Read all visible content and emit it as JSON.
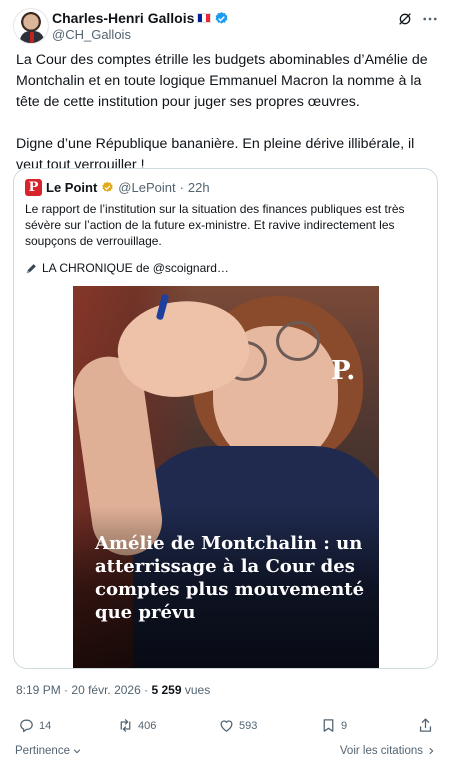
{
  "author": {
    "name": "Charles-Henri Gallois",
    "handle": "@CH_Gallois",
    "flag_colors": [
      "#002395",
      "#ffffff",
      "#ed2939"
    ],
    "verified_color": "#1d9bf0"
  },
  "tweet": {
    "paragraphs": [
      "La Cour des comptes étrille les budgets abominables d’Amélie de Montchalin et en toute logique Emmanuel Macron la nomme à la tête de cette institution pour juger ses propres œuvres.",
      "Digne d’une République bananière. En pleine dérive illibérale, il veut tout verrouiller !"
    ]
  },
  "quote": {
    "avatar_letter": "P",
    "name": "Le Point",
    "handle": "@LePoint",
    "separator": "·",
    "time": "22h",
    "text": "Le rapport de l’institution sur la situation des finances publiques est très sévère sur l’action de la future ex-ministre. Et ravive indirectement les soupçons de verrouillage.",
    "chronique": "LA CHRONIQUE de @scoignard…",
    "image": {
      "logo": "P.",
      "headline": "Amélie de Montchalin : un atterrissage à la Cour des comptes plus mouvementé que prévu"
    },
    "verified_color": "#e3a81b"
  },
  "meta": {
    "time": "8:19 PM",
    "sep1": "·",
    "date": "20 févr. 2026",
    "sep2": "·",
    "views_count": "5 259",
    "views_label": "vues"
  },
  "actions": {
    "replies": "14",
    "reposts": "406",
    "likes": "593",
    "bookmarks": "9"
  },
  "footer": {
    "sort_label": "Pertinence",
    "quotes_link": "Voir les citations"
  },
  "icons": [
    "grok-icon",
    "more-icon",
    "reply-icon",
    "repost-icon",
    "like-icon",
    "bookmark-icon",
    "share-icon",
    "pen-icon",
    "chevron-down-icon",
    "chevron-right-icon"
  ]
}
